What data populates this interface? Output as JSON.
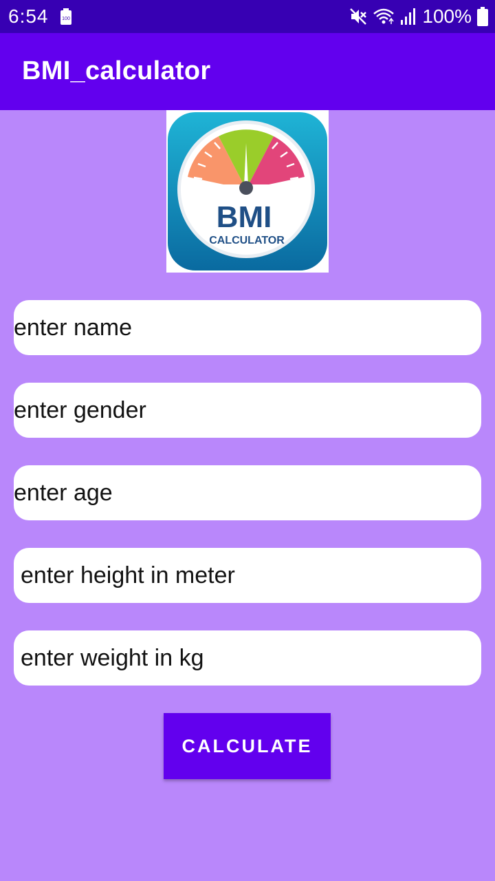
{
  "status_bar": {
    "time": "6:54",
    "battery_small": "100",
    "battery_percent": "100%",
    "icons": [
      "mute-icon",
      "wifi-icon",
      "signal-icon",
      "battery-icon"
    ]
  },
  "app_bar": {
    "title": "BMI_calculator"
  },
  "logo": {
    "line1": "BMI",
    "line2": "CALCULATOR"
  },
  "fields": [
    {
      "placeholder": "enter name"
    },
    {
      "placeholder": "enter gender"
    },
    {
      "placeholder": "enter age"
    },
    {
      "placeholder": "enter height in meter"
    },
    {
      "placeholder": "enter weight in kg"
    }
  ],
  "calculate_button": {
    "label": "CALCULATE"
  },
  "colors": {
    "background": "#b987fb",
    "status_bar": "#3700b3",
    "app_bar": "#6200ee",
    "button": "#6200ee"
  }
}
